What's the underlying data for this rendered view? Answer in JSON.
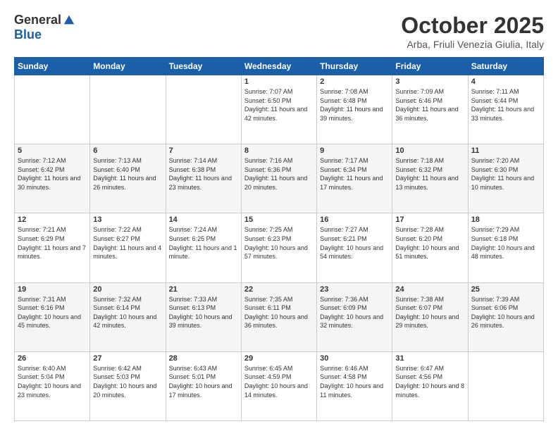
{
  "header": {
    "logo_general": "General",
    "logo_blue": "Blue",
    "month_title": "October 2025",
    "location": "Arba, Friuli Venezia Giulia, Italy"
  },
  "days_of_week": [
    "Sunday",
    "Monday",
    "Tuesday",
    "Wednesday",
    "Thursday",
    "Friday",
    "Saturday"
  ],
  "weeks": [
    [
      {
        "day": "",
        "info": ""
      },
      {
        "day": "",
        "info": ""
      },
      {
        "day": "",
        "info": ""
      },
      {
        "day": "1",
        "info": "Sunrise: 7:07 AM\nSunset: 6:50 PM\nDaylight: 11 hours and 42 minutes."
      },
      {
        "day": "2",
        "info": "Sunrise: 7:08 AM\nSunset: 6:48 PM\nDaylight: 11 hours and 39 minutes."
      },
      {
        "day": "3",
        "info": "Sunrise: 7:09 AM\nSunset: 6:46 PM\nDaylight: 11 hours and 36 minutes."
      },
      {
        "day": "4",
        "info": "Sunrise: 7:11 AM\nSunset: 6:44 PM\nDaylight: 11 hours and 33 minutes."
      }
    ],
    [
      {
        "day": "5",
        "info": "Sunrise: 7:12 AM\nSunset: 6:42 PM\nDaylight: 11 hours and 30 minutes."
      },
      {
        "day": "6",
        "info": "Sunrise: 7:13 AM\nSunset: 6:40 PM\nDaylight: 11 hours and 26 minutes."
      },
      {
        "day": "7",
        "info": "Sunrise: 7:14 AM\nSunset: 6:38 PM\nDaylight: 11 hours and 23 minutes."
      },
      {
        "day": "8",
        "info": "Sunrise: 7:16 AM\nSunset: 6:36 PM\nDaylight: 11 hours and 20 minutes."
      },
      {
        "day": "9",
        "info": "Sunrise: 7:17 AM\nSunset: 6:34 PM\nDaylight: 11 hours and 17 minutes."
      },
      {
        "day": "10",
        "info": "Sunrise: 7:18 AM\nSunset: 6:32 PM\nDaylight: 11 hours and 13 minutes."
      },
      {
        "day": "11",
        "info": "Sunrise: 7:20 AM\nSunset: 6:30 PM\nDaylight: 11 hours and 10 minutes."
      }
    ],
    [
      {
        "day": "12",
        "info": "Sunrise: 7:21 AM\nSunset: 6:29 PM\nDaylight: 11 hours and 7 minutes."
      },
      {
        "day": "13",
        "info": "Sunrise: 7:22 AM\nSunset: 6:27 PM\nDaylight: 11 hours and 4 minutes."
      },
      {
        "day": "14",
        "info": "Sunrise: 7:24 AM\nSunset: 6:25 PM\nDaylight: 11 hours and 1 minute."
      },
      {
        "day": "15",
        "info": "Sunrise: 7:25 AM\nSunset: 6:23 PM\nDaylight: 10 hours and 57 minutes."
      },
      {
        "day": "16",
        "info": "Sunrise: 7:27 AM\nSunset: 6:21 PM\nDaylight: 10 hours and 54 minutes."
      },
      {
        "day": "17",
        "info": "Sunrise: 7:28 AM\nSunset: 6:20 PM\nDaylight: 10 hours and 51 minutes."
      },
      {
        "day": "18",
        "info": "Sunrise: 7:29 AM\nSunset: 6:18 PM\nDaylight: 10 hours and 48 minutes."
      }
    ],
    [
      {
        "day": "19",
        "info": "Sunrise: 7:31 AM\nSunset: 6:16 PM\nDaylight: 10 hours and 45 minutes."
      },
      {
        "day": "20",
        "info": "Sunrise: 7:32 AM\nSunset: 6:14 PM\nDaylight: 10 hours and 42 minutes."
      },
      {
        "day": "21",
        "info": "Sunrise: 7:33 AM\nSunset: 6:13 PM\nDaylight: 10 hours and 39 minutes."
      },
      {
        "day": "22",
        "info": "Sunrise: 7:35 AM\nSunset: 6:11 PM\nDaylight: 10 hours and 36 minutes."
      },
      {
        "day": "23",
        "info": "Sunrise: 7:36 AM\nSunset: 6:09 PM\nDaylight: 10 hours and 32 minutes."
      },
      {
        "day": "24",
        "info": "Sunrise: 7:38 AM\nSunset: 6:07 PM\nDaylight: 10 hours and 29 minutes."
      },
      {
        "day": "25",
        "info": "Sunrise: 7:39 AM\nSunset: 6:06 PM\nDaylight: 10 hours and 26 minutes."
      }
    ],
    [
      {
        "day": "26",
        "info": "Sunrise: 6:40 AM\nSunset: 5:04 PM\nDaylight: 10 hours and 23 minutes."
      },
      {
        "day": "27",
        "info": "Sunrise: 6:42 AM\nSunset: 5:03 PM\nDaylight: 10 hours and 20 minutes."
      },
      {
        "day": "28",
        "info": "Sunrise: 6:43 AM\nSunset: 5:01 PM\nDaylight: 10 hours and 17 minutes."
      },
      {
        "day": "29",
        "info": "Sunrise: 6:45 AM\nSunset: 4:59 PM\nDaylight: 10 hours and 14 minutes."
      },
      {
        "day": "30",
        "info": "Sunrise: 6:46 AM\nSunset: 4:58 PM\nDaylight: 10 hours and 11 minutes."
      },
      {
        "day": "31",
        "info": "Sunrise: 6:47 AM\nSunset: 4:56 PM\nDaylight: 10 hours and 8 minutes."
      },
      {
        "day": "",
        "info": ""
      }
    ]
  ]
}
